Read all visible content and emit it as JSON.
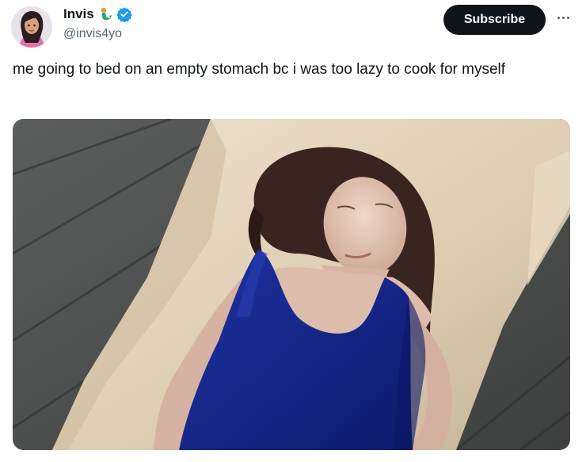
{
  "author": {
    "display_name": "Invis",
    "name_emoji": "merperson-emoji-icon",
    "verified": true,
    "handle": "@invis4yo",
    "avatar_icon": "cartoon-avatar-icon"
  },
  "actions": {
    "subscribe_label": "Subscribe",
    "more_icon": "more-horizontal-icon"
  },
  "post": {
    "text": "me going to bed on an empty stomach bc i was too lazy to cook for myself"
  },
  "media": {
    "description_icon": "photo-woman-lying-on-bed-icon"
  },
  "colors": {
    "verified_blue": "#1d9bf0",
    "button_bg": "#0f1419",
    "secondary_text": "#536471"
  }
}
